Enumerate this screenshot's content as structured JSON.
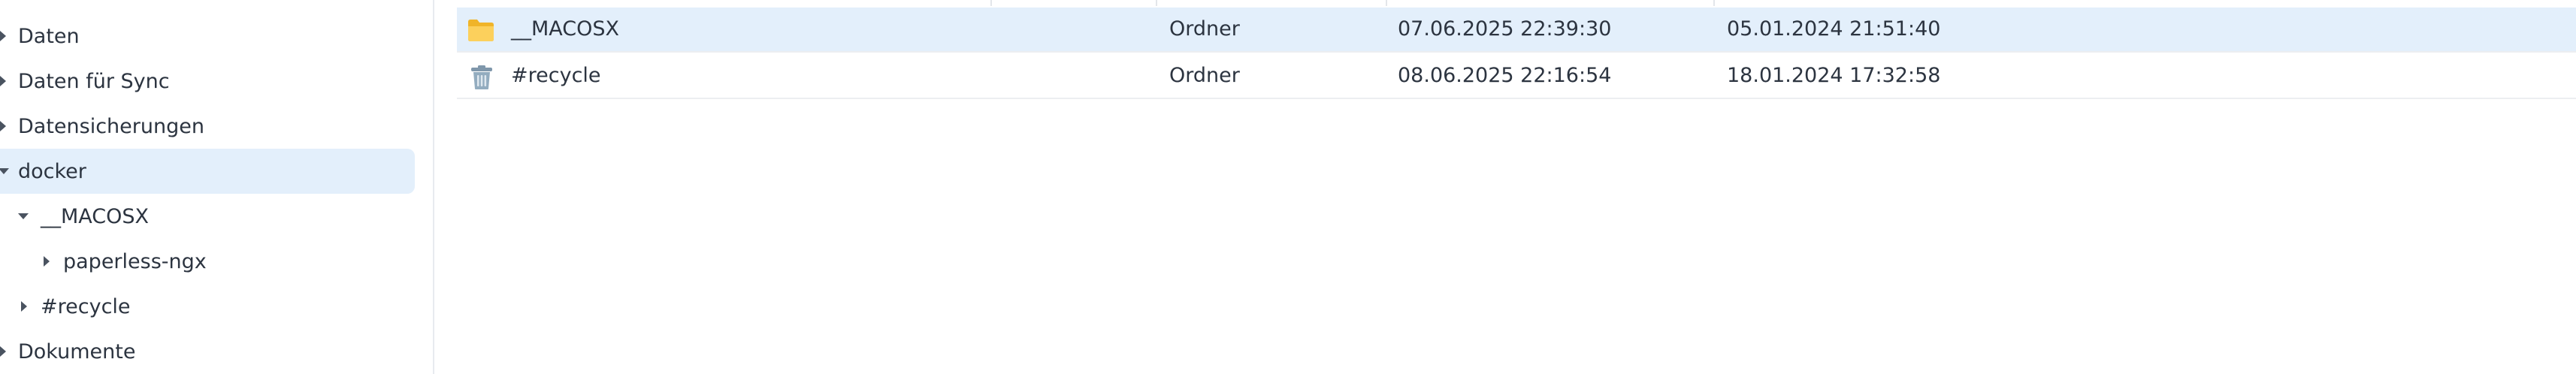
{
  "sidebar": {
    "items": [
      {
        "label": "Daten"
      },
      {
        "label": "Daten für Sync"
      },
      {
        "label": "Datensicherungen"
      },
      {
        "label": "docker"
      },
      {
        "label": "__MACOSX"
      },
      {
        "label": "paperless-ngx"
      },
      {
        "label": "#recycle"
      },
      {
        "label": "Dokumente"
      }
    ]
  },
  "files": {
    "rows": [
      {
        "name": "__MACOSX",
        "type": "Ordner",
        "modified": "07.06.2025 22:39:30",
        "created": "05.01.2024 21:51:40",
        "icon": "folder-icon"
      },
      {
        "name": "#recycle",
        "type": "Ordner",
        "modified": "08.06.2025 22:16:54",
        "created": "18.01.2024 17:32:58",
        "icon": "recycle-bin-icon"
      }
    ]
  },
  "colors": {
    "selection": "#e3effb",
    "folder": "#f7c545",
    "recycle": "#8aa4b8"
  }
}
